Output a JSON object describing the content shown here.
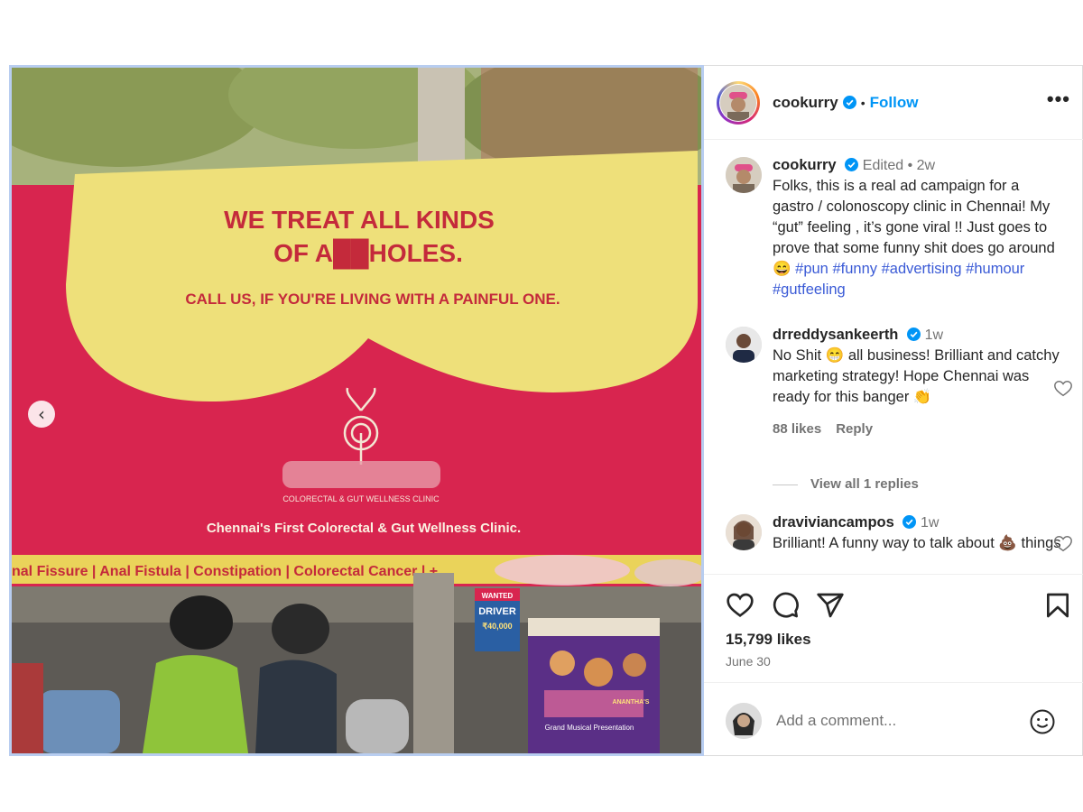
{
  "header": {
    "username": "cookurry",
    "follow_label": "Follow",
    "separator": "•",
    "more_label": "•••"
  },
  "media": {
    "billboard": {
      "headline_line1": "WE TREAT ALL KINDS",
      "headline_line2": "OF A██HOLES.",
      "subline": "CALL US, IF YOU'RE LIVING WITH A PAINFUL ONE.",
      "clinic_small": "COLORECTAL & GUT WELLNESS CLINIC",
      "tagline": "Chennai's First Colorectal & Gut Wellness Clinic.",
      "bottom_strip": "nal Fissure | Anal Fistula | Constipation | Colorectal Cancer | +"
    },
    "poster_left": {
      "line1": "WANTED",
      "line2": "DRIVER",
      "line3": "₹40,000"
    },
    "poster_right": {
      "title": "Grand Musical Presentation",
      "name": "ANANTHA'S"
    },
    "prev_label": "‹"
  },
  "caption": {
    "username": "cookurry",
    "meta": "Edited • 2w",
    "text": "Folks, this  is a real ad campaign for a gastro / colonoscopy clinic in Chennai! My “gut” feeling , it’s gone viral !! Just goes to prove that some funny shit does go around 😄 ",
    "hashtags": [
      "#pun",
      "#funny",
      "#advertising",
      "#humour",
      "#gutfeeling"
    ]
  },
  "comments": [
    {
      "username": "drreddysankeerth",
      "time": "1w",
      "text": "No Shit 😁 all business! Brilliant and catchy marketing strategy! Hope Chennai was ready for this banger 👏",
      "likes": "88 likes",
      "reply_label": "Reply",
      "view_replies": "View all 1 replies"
    },
    {
      "username": "draviviancampos",
      "time": "1w",
      "text": "Brilliant! A funny way to talk about 💩 things"
    }
  ],
  "actions": {
    "like_icon": "heart-icon",
    "comment_icon": "comment-icon",
    "share_icon": "paper-plane-icon",
    "save_icon": "bookmark-icon"
  },
  "stats": {
    "likes": "15,799 likes",
    "date": "June 30"
  },
  "add_comment": {
    "placeholder": "Add a comment...",
    "emoji_icon": "smiley-icon"
  },
  "colors": {
    "billboard_red": "#d8254f",
    "billboard_yellow": "#eee07a",
    "link_blue": "#0095f6",
    "hashtag_blue": "#3a5ad6",
    "verified_blue": "#0095f6"
  }
}
